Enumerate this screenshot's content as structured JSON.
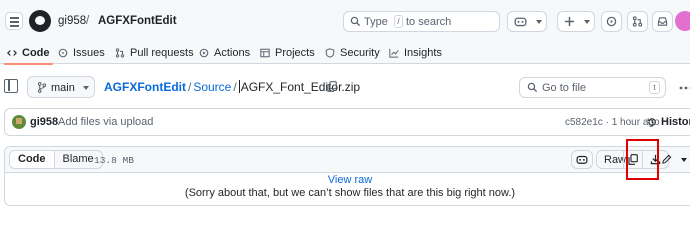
{
  "header": {
    "owner": "gi958",
    "separator": "/",
    "repo": "AGFXFontEdit",
    "search_prefix": "Type",
    "search_key": "/",
    "search_suffix": "to search"
  },
  "repo_nav": {
    "tabs": [
      {
        "label": "Code",
        "icon": "code-icon"
      },
      {
        "label": "Issues",
        "icon": "issue-icon"
      },
      {
        "label": "Pull requests",
        "icon": "pull-request-icon"
      },
      {
        "label": "Actions",
        "icon": "play-icon"
      },
      {
        "label": "Projects",
        "icon": "table-icon"
      },
      {
        "label": "Security",
        "icon": "shield-icon"
      },
      {
        "label": "Insights",
        "icon": "graph-icon"
      }
    ]
  },
  "file_header": {
    "branch": "main",
    "path_repo": "AGFXFontEdit",
    "path_dir": "Source",
    "path_sep": "/",
    "file_name": "AGFX_Font_Editor.zip",
    "go_to_file_placeholder": "Go to file",
    "go_to_file_key": "t"
  },
  "commit": {
    "author": "gi958",
    "message": "Add files via upload",
    "sha": "c582e1c",
    "dot": "·",
    "time": "1 hour ago",
    "history_label": "History"
  },
  "viewer": {
    "tab_code": "Code",
    "tab_blame": "Blame",
    "file_size": "13.8 MB",
    "raw_label": "Raw",
    "view_raw": "View raw",
    "too_big_message": "(Sorry about that, but we can’t show files that are this big right now.)"
  },
  "colors": {
    "accent_link": "#0969da",
    "tab_underline": "#fd8c73",
    "highlight_box": "#e00000"
  }
}
